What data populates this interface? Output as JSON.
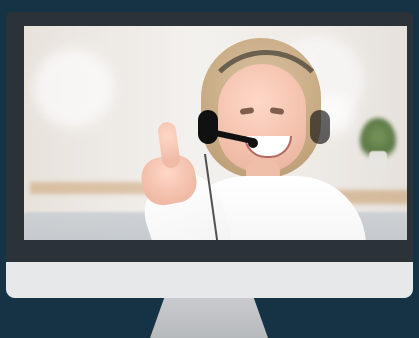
{
  "image": {
    "subject": "",
    "visible_text": []
  },
  "colors": {
    "background": "#163245",
    "monitor_bezel": "#2c3338",
    "monitor_chin": "#e7e8ea",
    "stand": "#c9cbce"
  },
  "icons": {
    "monitor": "monitor-icon"
  }
}
